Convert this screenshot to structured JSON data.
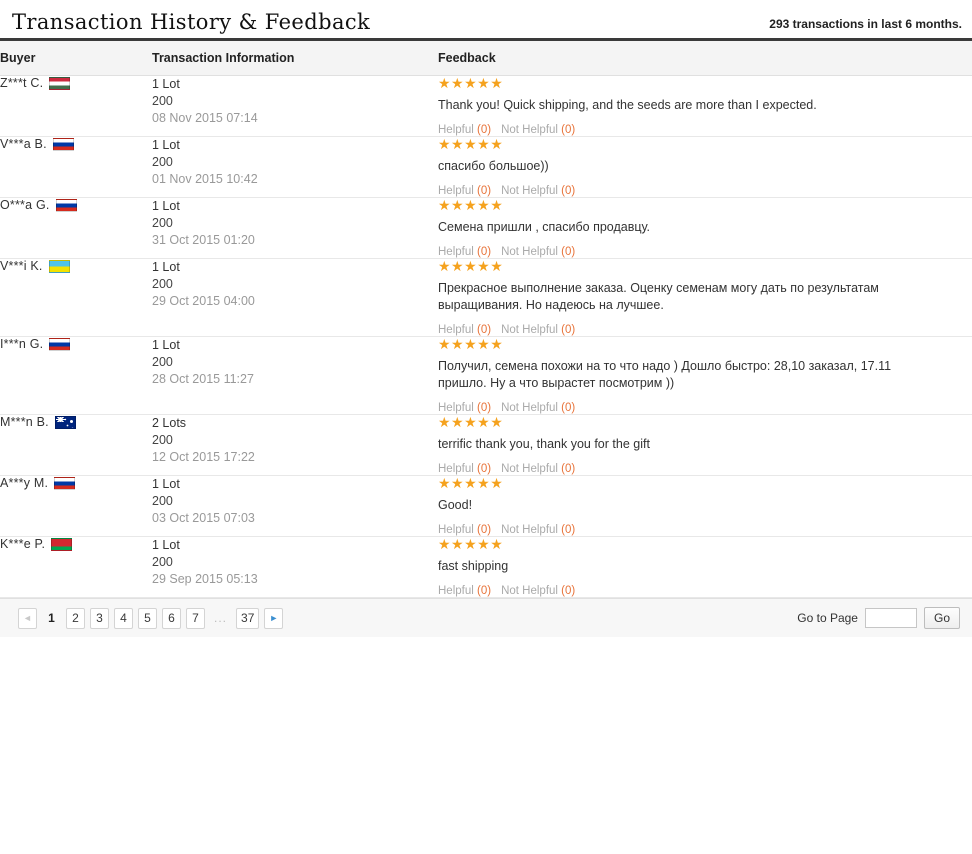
{
  "header": {
    "title": "Transaction History & Feedback",
    "transaction_count_text": "293 transactions in last 6 months."
  },
  "table": {
    "columns": {
      "buyer": "Buyer",
      "transaction": "Transaction Information",
      "feedback": "Feedback"
    },
    "helpful_label": "Helpful",
    "not_helpful_label": "Not Helpful",
    "helpful_count": "(0)",
    "not_helpful_count": "(0)",
    "stars": "★★★★★",
    "rows": [
      {
        "buyer": "Z***t C.",
        "flag": "hu",
        "quantity": "1 Lot",
        "amount": "200",
        "date": "08 Nov 2015 07:14",
        "feedback": "Thank you! Quick shipping, and the seeds are more than I expected.",
        "rating": 5
      },
      {
        "buyer": "V***a B.",
        "flag": "ru",
        "quantity": "1 Lot",
        "amount": "200",
        "date": "01 Nov 2015 10:42",
        "feedback": "спасибо большое))",
        "rating": 5
      },
      {
        "buyer": "O***a G.",
        "flag": "ru",
        "quantity": "1 Lot",
        "amount": "200",
        "date": "31 Oct 2015 01:20",
        "feedback": "Семена пришли , спасибо продавцу.",
        "rating": 5
      },
      {
        "buyer": "V***i K.",
        "flag": "ua",
        "quantity": "1 Lot",
        "amount": "200",
        "date": "29 Oct 2015 04:00",
        "feedback": "Прекрасное выполнение заказа. Оценку семенам могу дать по результатам выращивания. Но надеюсь на лучшее.",
        "rating": 5
      },
      {
        "buyer": "I***n G.",
        "flag": "ru",
        "quantity": "1 Lot",
        "amount": "200",
        "date": "28 Oct 2015 11:27",
        "feedback": "Получил, семена похожи на то что надо ) Дошло быстро: 28,10 заказал, 17.11 пришло. Ну а что вырастет посмотрим ))",
        "rating": 5
      },
      {
        "buyer": "M***n B.",
        "flag": "au",
        "quantity": "2 Lots",
        "amount": "200",
        "date": "12 Oct 2015 17:22",
        "feedback": "terrific thank you, thank you for the gift",
        "rating": 5
      },
      {
        "buyer": "A***y M.",
        "flag": "ru",
        "quantity": "1 Lot",
        "amount": "200",
        "date": "03 Oct 2015 07:03",
        "feedback": "Good!",
        "rating": 5
      },
      {
        "buyer": "K***e P.",
        "flag": "by",
        "quantity": "1 Lot",
        "amount": "200",
        "date": "29 Sep 2015 05:13",
        "feedback": "fast shipping",
        "rating": 5
      }
    ]
  },
  "footer": {
    "prev_arrow": "◄",
    "next_arrow": "►",
    "pages": [
      "1",
      "2",
      "3",
      "4",
      "5",
      "6",
      "7"
    ],
    "ellipsis": "...",
    "last_page": "37",
    "current_page": "1",
    "goto_label": "Go to Page",
    "goto_value": "",
    "goto_placeholder": "",
    "go_button": "Go"
  },
  "colors": {
    "star": "#f5a21e",
    "count": "#e8743b",
    "header_rule": "#3a3a3a"
  }
}
